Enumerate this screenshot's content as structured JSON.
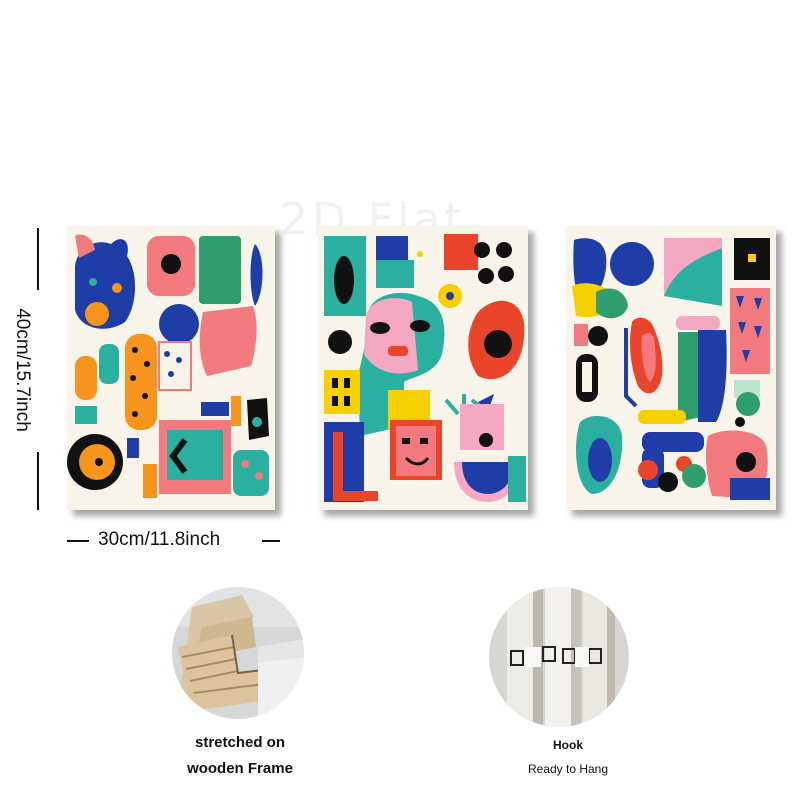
{
  "watermark": "2D Flat",
  "dimensions": {
    "height_label": "40cm/15.7inch",
    "width_label": "30cm/11.8inch"
  },
  "features": [
    {
      "line1": "stretched on",
      "line2": "wooden Frame"
    },
    {
      "line1": "Hook",
      "line2": "Ready to Hang"
    }
  ],
  "colors": {
    "cream": "#f8f4ea",
    "blue": "#1e3da6",
    "pink": "#f27a7e",
    "orange": "#f7941d",
    "teal": "#2bb0a0",
    "green": "#2f9e6e",
    "yellow": "#f6d000",
    "black": "#111111",
    "red": "#e9452a"
  }
}
